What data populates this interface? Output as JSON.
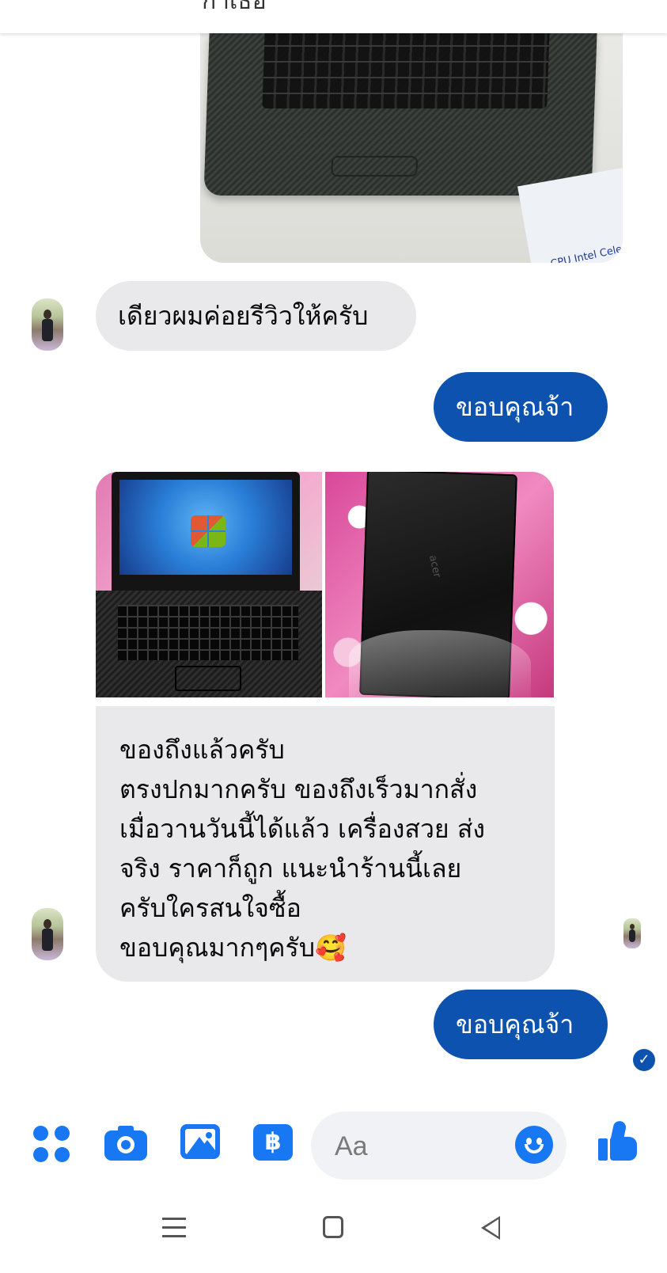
{
  "header": {
    "title_fragment": "กาเธอ"
  },
  "messages": {
    "incoming_1": "เดียวผมค่อยรีวิวให้ครับ",
    "outgoing_1": "ขอบคุณจ้า",
    "incoming_long": [
      "ของถึงแล้วครับ",
      "ตรงปกมากครับ ของถึงเร็วมากสั่ง",
      "เมื่อวานวันนี้ได้แล้ว เครื่องสวย ส่ง",
      "จริง ราคาก็ถูก แนะนำร้านนี้เลย",
      "ครับใครสนใจซื้อ",
      "ขอบคุณมากๆครับ🥰"
    ],
    "outgoing_2": "ขอบคุณจ้า"
  },
  "photos": {
    "laptop_label": "CPU Intel Cele",
    "lid_brand": "acer"
  },
  "composer": {
    "placeholder": "Aa",
    "pay_symbol": "฿"
  },
  "status": {
    "seen_icon": "✓"
  },
  "colors": {
    "outgoing_bubble": "#0d52ae",
    "incoming_bubble": "#e9e9eb",
    "accent": "#1877f2"
  },
  "icons": [
    "menu-grid-icon",
    "camera-icon",
    "gallery-icon",
    "payment-icon",
    "emoji-icon",
    "like-icon",
    "nav-menu-icon",
    "nav-home-icon",
    "nav-back-icon"
  ]
}
